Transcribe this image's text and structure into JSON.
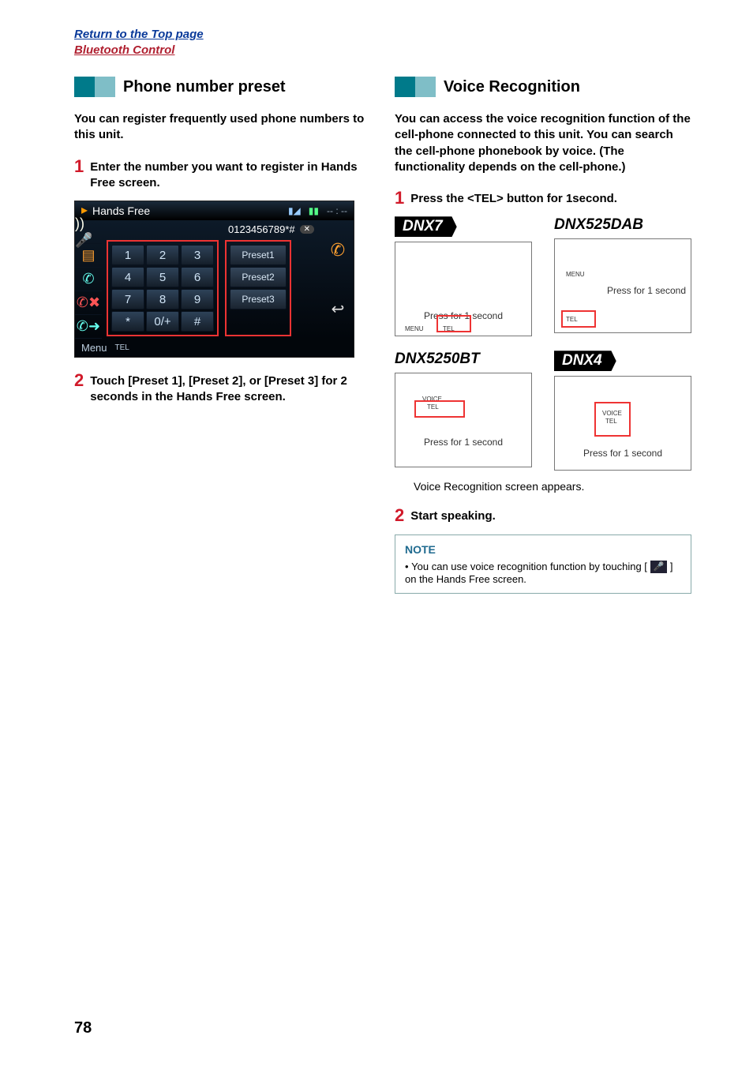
{
  "top_links": {
    "return": "Return to the Top page",
    "section": "Bluetooth Control"
  },
  "left": {
    "title": "Phone number preset",
    "intro": "You can register frequently used phone numbers to this unit.",
    "step1_n": "1",
    "step1": "Enter the number you want to register in Hands Free screen.",
    "step2_n": "2",
    "step2": "Touch [Preset 1], [Preset 2], or [Preset 3] for 2 seconds in the Hands Free screen.",
    "hf": {
      "title": "Hands Free",
      "display": "0123456789*#",
      "keys": [
        "1",
        "2",
        "3",
        "4",
        "5",
        "6",
        "7",
        "8",
        "9",
        "*",
        "0/+",
        "#"
      ],
      "presets": [
        "Preset1",
        "Preset2",
        "Preset3"
      ],
      "menu": "Menu",
      "tel": "TEL"
    }
  },
  "right": {
    "title": "Voice Recognition",
    "intro": "You can access the voice recognition function of the cell-phone connected to this unit. You can search the cell-phone phonebook by voice. (The functionality depends on the cell-phone.)",
    "step1_n": "1",
    "step1": "Press the <TEL> button for 1second.",
    "models": {
      "m1_badge": "DNX7",
      "m2_name": "DNX525DAB",
      "m3_name": "DNX5250BT",
      "m4_badge": "DNX4"
    },
    "press_label": "Press for 1 second",
    "menu_label": "MENU",
    "tel_label": "TEL",
    "voice_label": "VOICE",
    "result": "Voice Recognition screen appears.",
    "step2_n": "2",
    "step2": "Start speaking.",
    "note_title": "NOTE",
    "note_body_a": "You can use voice recognition function by touching [",
    "note_icon": "🎤",
    "note_body_b": "] on the Hands Free screen."
  },
  "page_number": "78"
}
